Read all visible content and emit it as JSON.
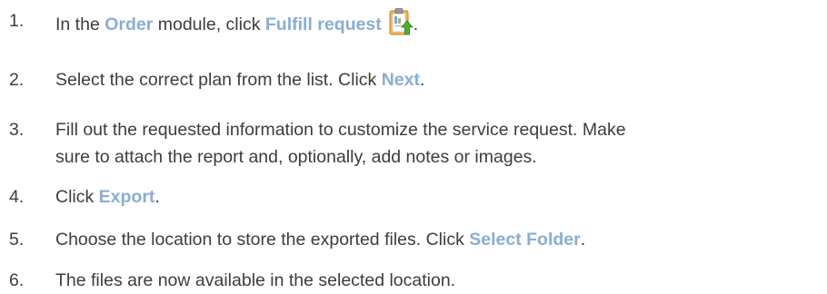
{
  "steps": [
    {
      "number": "1.",
      "text_before": "In the ",
      "ui1": "Order",
      "text_mid": " module, click ",
      "ui2": "Fulfill request",
      "icon": "clipboard-upload-icon",
      "text_after": "."
    },
    {
      "number": "2.",
      "text_before": "Select the correct plan from the list. Click ",
      "ui1": "Next",
      "text_after": "."
    },
    {
      "number": "3.",
      "line1": "Fill out the requested information to customize the service request. Make",
      "line2": "sure to attach the report and, optionally, add notes or images."
    },
    {
      "number": "4.",
      "text_before": "Click ",
      "ui1": "Export",
      "text_after": "."
    },
    {
      "number": "5.",
      "text_before": "Choose the location to store the exported files. Click ",
      "ui1": "Select Folder",
      "text_after": "."
    },
    {
      "number": "6.",
      "text": "The files are now available in the selected location."
    }
  ],
  "colors": {
    "body_text": "#3d3d3d",
    "ui_term": "#8aaed0"
  }
}
